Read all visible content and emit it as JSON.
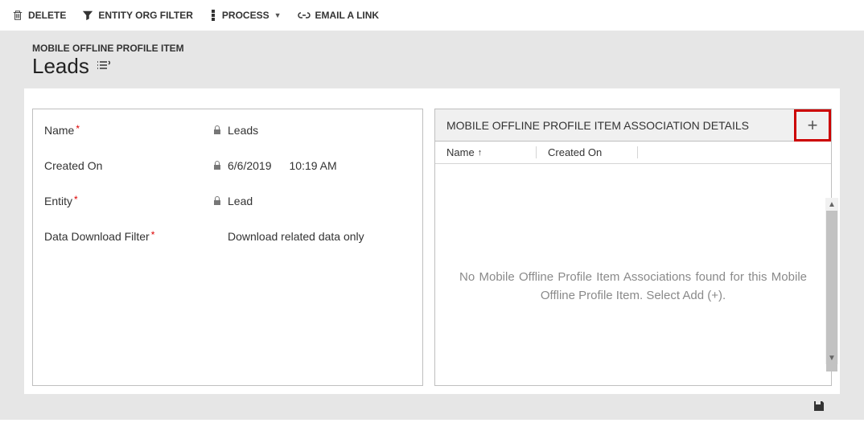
{
  "toolbar": {
    "delete": "DELETE",
    "entityOrgFilter": "ENTITY ORG FILTER",
    "process": "PROCESS",
    "emailALink": "EMAIL A LINK"
  },
  "header": {
    "entityLabel": "MOBILE OFFLINE PROFILE ITEM",
    "title": "Leads"
  },
  "form": {
    "nameLabel": "Name",
    "nameValue": "Leads",
    "createdOnLabel": "Created On",
    "createdOnDate": "6/6/2019",
    "createdOnTime": "10:19 AM",
    "entityLabel": "Entity",
    "entityValue": "Lead",
    "dataDlLabel": "Data Download Filter",
    "dataDlValue": "Download related data only"
  },
  "associations": {
    "title": "MOBILE OFFLINE PROFILE ITEM ASSOCIATION DETAILS",
    "colName": "Name",
    "colCreatedOn": "Created On",
    "emptyMsg": "No Mobile Offline Profile Item Associations found for this Mobile Offline Profile Item. Select Add (+)."
  }
}
